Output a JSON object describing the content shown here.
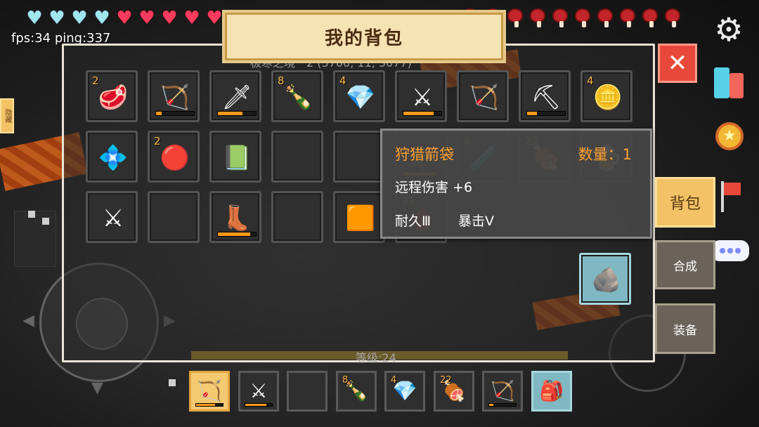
{
  "hud": {
    "fps_ping": "fps:34 ping:337",
    "armor_hearts": 4,
    "health_hearts": 6,
    "hunger_drumsticks": 10
  },
  "inventory": {
    "title": "我的背包",
    "subtitle": "极寒之境　2 (3700, 11, 3077)",
    "level_label": "等级:24",
    "slots": [
      {
        "icon": "🥩",
        "count": "2",
        "name": "steak-icon"
      },
      {
        "icon": "🏹",
        "count": "",
        "name": "crossbow-icon",
        "durability": 0.15
      },
      {
        "icon": "🗡",
        "count": "",
        "name": "golden-dagger-icon",
        "durability": 0.65
      },
      {
        "icon": "🍾",
        "count": "8",
        "name": "bottle-icon"
      },
      {
        "icon": "💎",
        "count": "4",
        "name": "ice-ore-icon"
      },
      {
        "icon": "⚔",
        "count": "",
        "name": "diamond-sword-icon",
        "durability": 0.8
      },
      {
        "icon": "🏹",
        "count": "",
        "name": "arrow-quiver-icon"
      },
      {
        "icon": "⛏",
        "count": "",
        "name": "diamond-pickaxe-icon",
        "durability": 0.25
      },
      {
        "icon": "🪙",
        "count": "4",
        "name": "gold-ore-icon"
      },
      {
        "icon": "💠",
        "count": "",
        "name": "diamond-icon"
      },
      {
        "icon": "🔴",
        "count": "2",
        "name": "red-crystal-icon"
      },
      {
        "icon": "📗",
        "count": "",
        "name": "green-book-icon"
      },
      {
        "icon": "",
        "count": "",
        "name": "empty-slot"
      },
      {
        "icon": "",
        "count": "",
        "name": "empty-slot"
      },
      {
        "icon": "🪖",
        "count": "",
        "name": "helmet-icon",
        "durability": 0.85
      },
      {
        "icon": "🧪",
        "count": "4",
        "name": "red-potion-icon"
      },
      {
        "icon": "🍖",
        "count": "22",
        "name": "ribs-icon"
      },
      {
        "icon": "🍺",
        "count": "",
        "name": "juice-icon"
      },
      {
        "icon": "⚔",
        "count": "",
        "name": "ice-sword-icon"
      },
      {
        "icon": "",
        "count": "",
        "name": "empty-slot"
      },
      {
        "icon": "👢",
        "count": "",
        "name": "boots-icon",
        "durability": 0.85
      },
      {
        "icon": "",
        "count": "",
        "name": "empty-slot"
      },
      {
        "icon": "🟧",
        "count": "",
        "name": "lucky-box-icon"
      },
      {
        "icon": "🩸",
        "count": "33",
        "name": "red-slime-icon"
      }
    ],
    "extra_slot": {
      "icon": "🪨",
      "name": "stone-icon"
    }
  },
  "tooltip": {
    "name": "狩猎箭袋",
    "quantity": "数量：1",
    "line1": "远程伤害 +6",
    "line2a": "耐久Ⅲ",
    "line2b": "暴击Ⅴ"
  },
  "side_tabs": {
    "bag": "背包",
    "craft": "合成",
    "equip": "装备"
  },
  "hide_tab": "隐藏",
  "hotbar": [
    {
      "icon": "🏹",
      "count": "",
      "name": "arrow-quiver-icon",
      "durability": 0.7,
      "selected": true
    },
    {
      "icon": "⚔",
      "count": "",
      "name": "diamond-sword-icon",
      "durability": 0.8
    },
    {
      "icon": "",
      "count": "",
      "name": "empty-slot"
    },
    {
      "icon": "🍾",
      "count": "8",
      "name": "bottle-icon"
    },
    {
      "icon": "💎",
      "count": "4",
      "name": "ice-ore-icon"
    },
    {
      "icon": "🍖",
      "count": "22",
      "name": "ribs-icon"
    },
    {
      "icon": "🏹",
      "count": "",
      "name": "crossbow-icon",
      "durability": 0.15
    },
    {
      "icon": "🎒",
      "count": "",
      "name": "backpack-icon",
      "cyan": true
    }
  ],
  "colors": {
    "accent": "#f3c266",
    "close": "#e8483a",
    "tooltip_title": "#ffa030",
    "count": "#ffb84a"
  }
}
